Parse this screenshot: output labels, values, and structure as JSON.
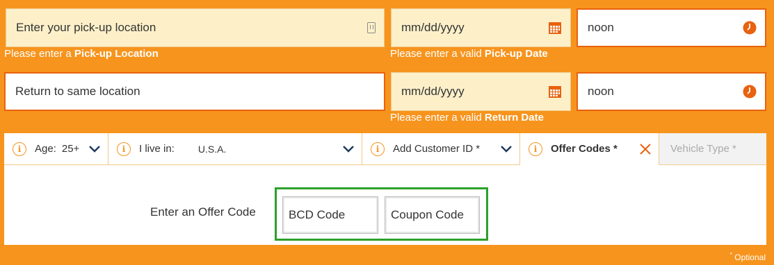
{
  "pickup": {
    "location_placeholder": "Enter your pick-up location",
    "location_error_prefix": "Please enter a ",
    "location_error_strong": "Pick-up Location",
    "date_placeholder": "mm/dd/yyyy",
    "date_error_prefix": "Please enter a valid ",
    "date_error_strong": "Pick-up Date",
    "time_value": "noon"
  },
  "return": {
    "location_value": "Return to same location",
    "date_placeholder": "mm/dd/yyyy",
    "date_error_prefix": "Please enter a valid ",
    "date_error_strong": "Return Date",
    "time_value": "noon"
  },
  "options": {
    "age_label": "Age:",
    "age_value": "25+",
    "live_label": "I live in:",
    "live_value": "U.S.A.",
    "customer_id_label": "Add Customer ID *",
    "offer_codes_label": "Offer Codes *",
    "vehicle_type_label": "Vehicle Type *",
    "info_glyph": "i"
  },
  "offer": {
    "label": "Enter an Offer Code",
    "bcd_placeholder": "BCD Code",
    "coupon_placeholder": "Coupon Code"
  },
  "footer": {
    "optional_mark": "*",
    "optional_text": " Optional"
  },
  "colors": {
    "background": "#f7941d",
    "accent": "#e8620f",
    "error_field": "#fdf0c9",
    "highlight": "#2ca02c"
  }
}
